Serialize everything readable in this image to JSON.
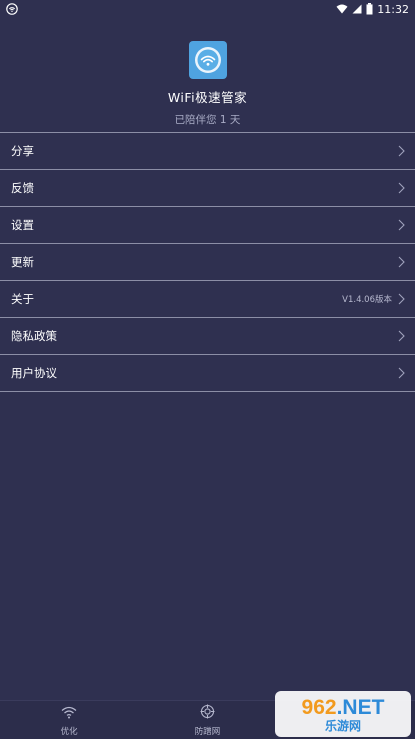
{
  "status_bar": {
    "time": "11:32",
    "icons": [
      "wifi-app-icon",
      "wifi-signal-icon",
      "cellular-signal-icon",
      "battery-icon"
    ]
  },
  "header": {
    "app_name": "WiFi极速管家",
    "companion_text": "已陪伴您 1 天"
  },
  "menu": {
    "items": [
      {
        "label": "分享",
        "value": ""
      },
      {
        "label": "反馈",
        "value": ""
      },
      {
        "label": "设置",
        "value": ""
      },
      {
        "label": "更新",
        "value": ""
      },
      {
        "label": "关于",
        "value": "V1.4.06版本"
      },
      {
        "label": "隐私政策",
        "value": ""
      },
      {
        "label": "用户协议",
        "value": ""
      }
    ]
  },
  "bottom_nav": {
    "items": [
      {
        "label": "优化",
        "icon": "wifi-icon"
      },
      {
        "label": "防蹭网",
        "icon": "crosshair-icon"
      }
    ]
  },
  "watermark": {
    "top_number": "962",
    "top_suffix": ".NET",
    "bottom": "乐游网"
  },
  "colors": {
    "background": "#2f3050",
    "divider": "#8c8ea6",
    "logo_blue": "#4fa3e0"
  }
}
